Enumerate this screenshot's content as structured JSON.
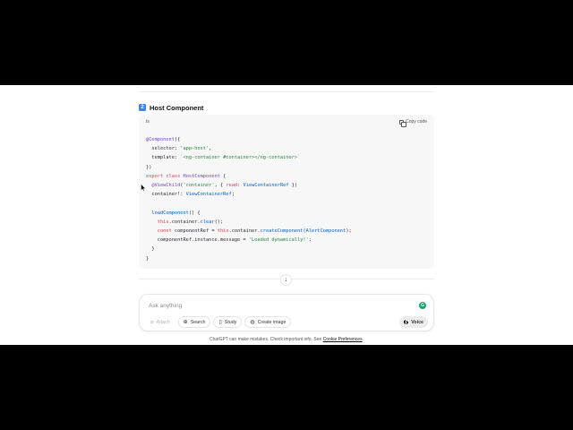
{
  "section": {
    "badge": "2",
    "title": "Host Component"
  },
  "code_block": {
    "language": "ts",
    "copy_label": "Copy code",
    "lines": [
      [
        {
          "t": "@Component",
          "c": "dec"
        },
        {
          "t": "({",
          "c": ""
        }
      ],
      [
        {
          "t": "  selector: ",
          "c": ""
        },
        {
          "t": "'app-host'",
          "c": "str"
        },
        {
          "t": ",",
          "c": ""
        }
      ],
      [
        {
          "t": "  template: ",
          "c": ""
        },
        {
          "t": "`<ng-container #container></ng-container>`",
          "c": "str"
        }
      ],
      [
        {
          "t": "})",
          "c": ""
        }
      ],
      [
        {
          "t": "export",
          "c": "key"
        },
        {
          "t": " ",
          "c": ""
        },
        {
          "t": "class",
          "c": "key"
        },
        {
          "t": " ",
          "c": ""
        },
        {
          "t": "HostComponent",
          "c": "cls"
        },
        {
          "t": " {",
          "c": ""
        }
      ],
      [
        {
          "t": "  ",
          "c": ""
        },
        {
          "t": "@ViewChild",
          "c": "dec"
        },
        {
          "t": "(",
          "c": ""
        },
        {
          "t": "'container'",
          "c": "str"
        },
        {
          "t": ", { ",
          "c": ""
        },
        {
          "t": "read",
          "c": "key"
        },
        {
          "t": ": ",
          "c": ""
        },
        {
          "t": "ViewContainerRef",
          "c": "typ"
        },
        {
          "t": " })",
          "c": ""
        }
      ],
      [
        {
          "t": "  container!: ",
          "c": ""
        },
        {
          "t": "ViewContainerRef",
          "c": "typ"
        },
        {
          "t": ";",
          "c": ""
        }
      ],
      [
        {
          "t": "",
          "c": ""
        }
      ],
      [
        {
          "t": "  ",
          "c": ""
        },
        {
          "t": "loadComponent",
          "c": "fn"
        },
        {
          "t": "() {",
          "c": ""
        }
      ],
      [
        {
          "t": "    ",
          "c": ""
        },
        {
          "t": "this",
          "c": "key"
        },
        {
          "t": ".container.",
          "c": ""
        },
        {
          "t": "clear",
          "c": "fn"
        },
        {
          "t": "();",
          "c": ""
        }
      ],
      [
        {
          "t": "    ",
          "c": ""
        },
        {
          "t": "const",
          "c": "key"
        },
        {
          "t": " componentRef = ",
          "c": ""
        },
        {
          "t": "this",
          "c": "key"
        },
        {
          "t": ".container.",
          "c": ""
        },
        {
          "t": "createComponent",
          "c": "fn"
        },
        {
          "t": "(",
          "c": ""
        },
        {
          "t": "AlertComponent",
          "c": "typ"
        },
        {
          "t": ");",
          "c": ""
        }
      ],
      [
        {
          "t": "    componentRef.instance.message = ",
          "c": ""
        },
        {
          "t": "'Loaded dynamically!'",
          "c": "str"
        },
        {
          "t": ";",
          "c": ""
        }
      ],
      [
        {
          "t": "  }",
          "c": ""
        }
      ],
      [
        {
          "t": "}",
          "c": ""
        }
      ]
    ]
  },
  "composer": {
    "placeholder": "Ask anything",
    "grammarly_icon": "G",
    "tools": [
      {
        "name": "attach-button",
        "icon": "paperclip-icon",
        "glyph": "⌀",
        "label": "Attach",
        "disabled": true
      },
      {
        "name": "search-button",
        "icon": "globe-icon",
        "glyph": "⊕",
        "label": "Search",
        "disabled": false
      },
      {
        "name": "study-button",
        "icon": "book-icon",
        "glyph": "▯",
        "label": "Study",
        "disabled": false
      },
      {
        "name": "create-image-button",
        "icon": "image-icon",
        "glyph": "◍",
        "label": "Create image",
        "disabled": false
      }
    ],
    "voice_label": "Voice"
  },
  "scroll_down_glyph": "↓",
  "footer": {
    "text": "ChatGPT can make mistakes. Check important info. See ",
    "link": "Cookie Preferences",
    "end": "."
  }
}
